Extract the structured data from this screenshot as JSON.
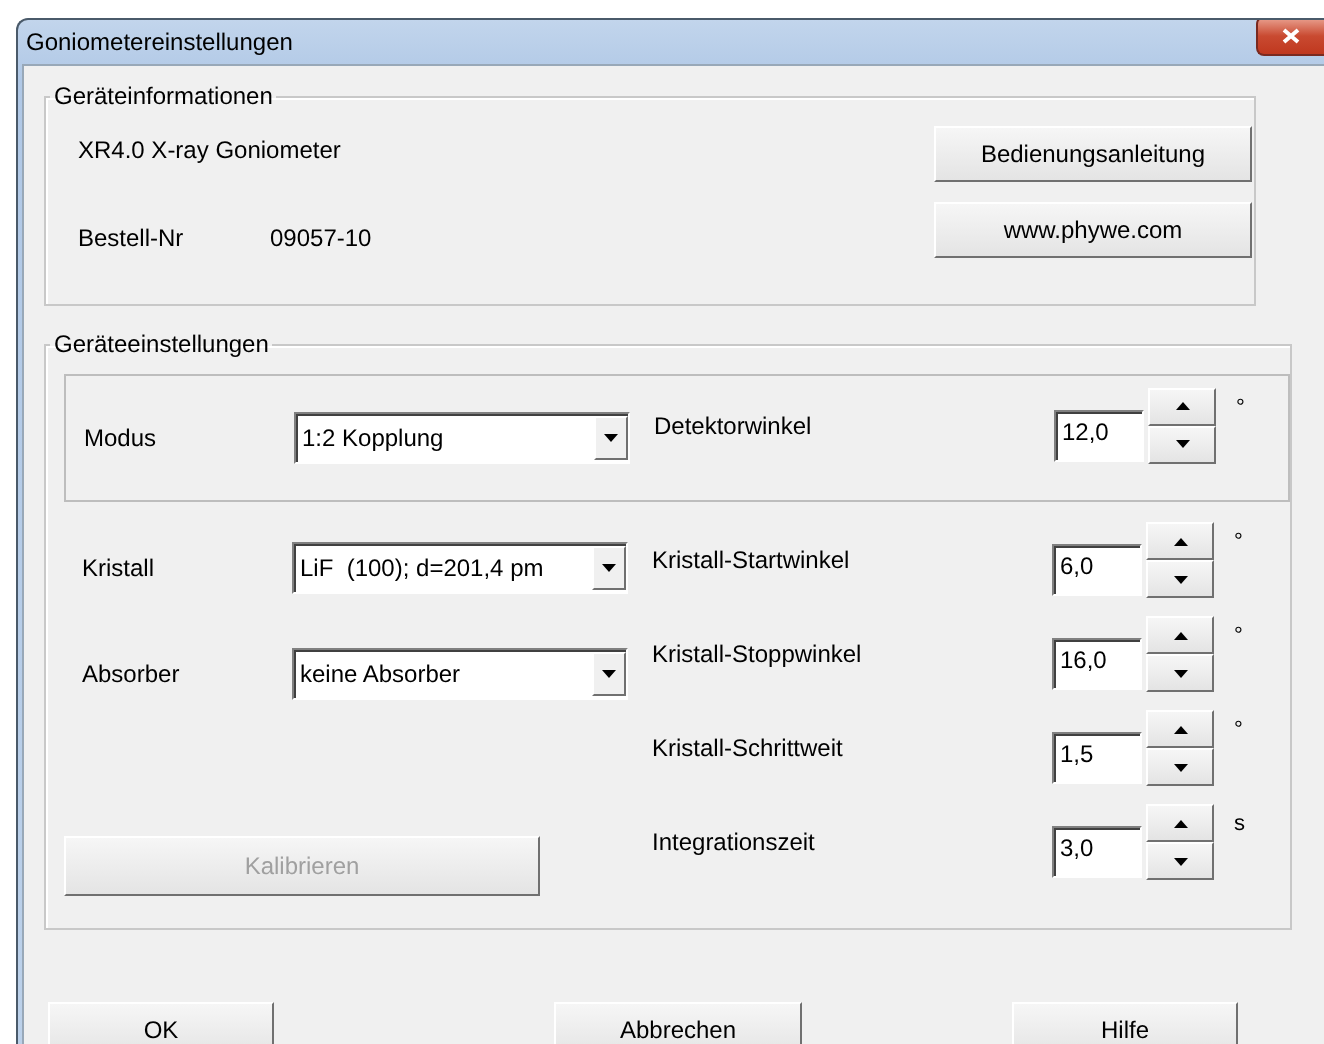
{
  "window": {
    "title": "Goniometereinstellungen"
  },
  "device_info": {
    "title": "Geräteinformationen",
    "device_name": "XR4.0 X-ray Goniometer",
    "order_label": "Bestell-Nr",
    "order_number": "09057-10",
    "buttons": [
      "Bedienungsanleitung",
      "www.phywe.com"
    ]
  },
  "settings": {
    "title": "Geräteeinstellungen",
    "mode": {
      "label": "Modus",
      "value": "1:2 Kopplung"
    },
    "detector": {
      "label": "Detektorwinkel",
      "value": "12,0",
      "unit": "°"
    },
    "combos": [
      {
        "label": "Kristall",
        "value": "LiF  (100); d=201,4 pm"
      },
      {
        "label": "Absorber",
        "value": "keine Absorber"
      }
    ],
    "calibrate": {
      "label": "Kalibrieren",
      "disabled": true
    },
    "spinners": [
      {
        "label": "Kristall-Startwinkel",
        "value": "6,0",
        "unit": "°"
      },
      {
        "label": "Kristall-Stoppwinkel",
        "value": "16,0",
        "unit": "°"
      },
      {
        "label": "Kristall-Schrittweit",
        "value": "1,5",
        "unit": "°"
      },
      {
        "label": "Integrationszeit",
        "value": "3,0",
        "unit": "s"
      }
    ]
  },
  "buttons": [
    "OK",
    "Abbrechen",
    "Hilfe"
  ]
}
